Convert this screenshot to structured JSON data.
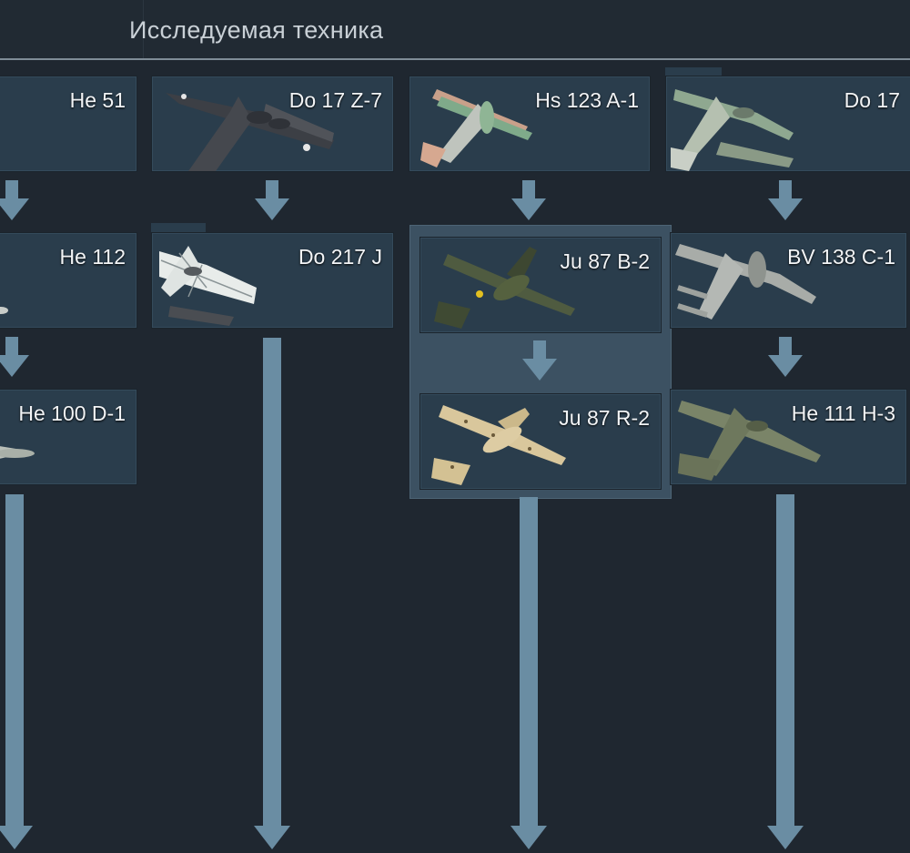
{
  "header": {
    "title": "Исследуемая техника"
  },
  "columns": [
    {
      "items": [
        "He 51",
        "He 112",
        "He 100 D-1"
      ]
    },
    {
      "items": [
        "Do 17 Z-7",
        "Do 217 J"
      ]
    },
    {
      "items": [
        "Hs 123 A-1",
        "Ju 87 B-2",
        "Ju 87 R-2"
      ]
    },
    {
      "items": [
        "Do 17",
        "BV 138 C-1",
        "He 111 H-3"
      ]
    }
  ],
  "colors": {
    "background": "#1f2730",
    "card": "#2a3d4c",
    "group_panel": "#3c5162",
    "arrow": "#6a8da3"
  }
}
